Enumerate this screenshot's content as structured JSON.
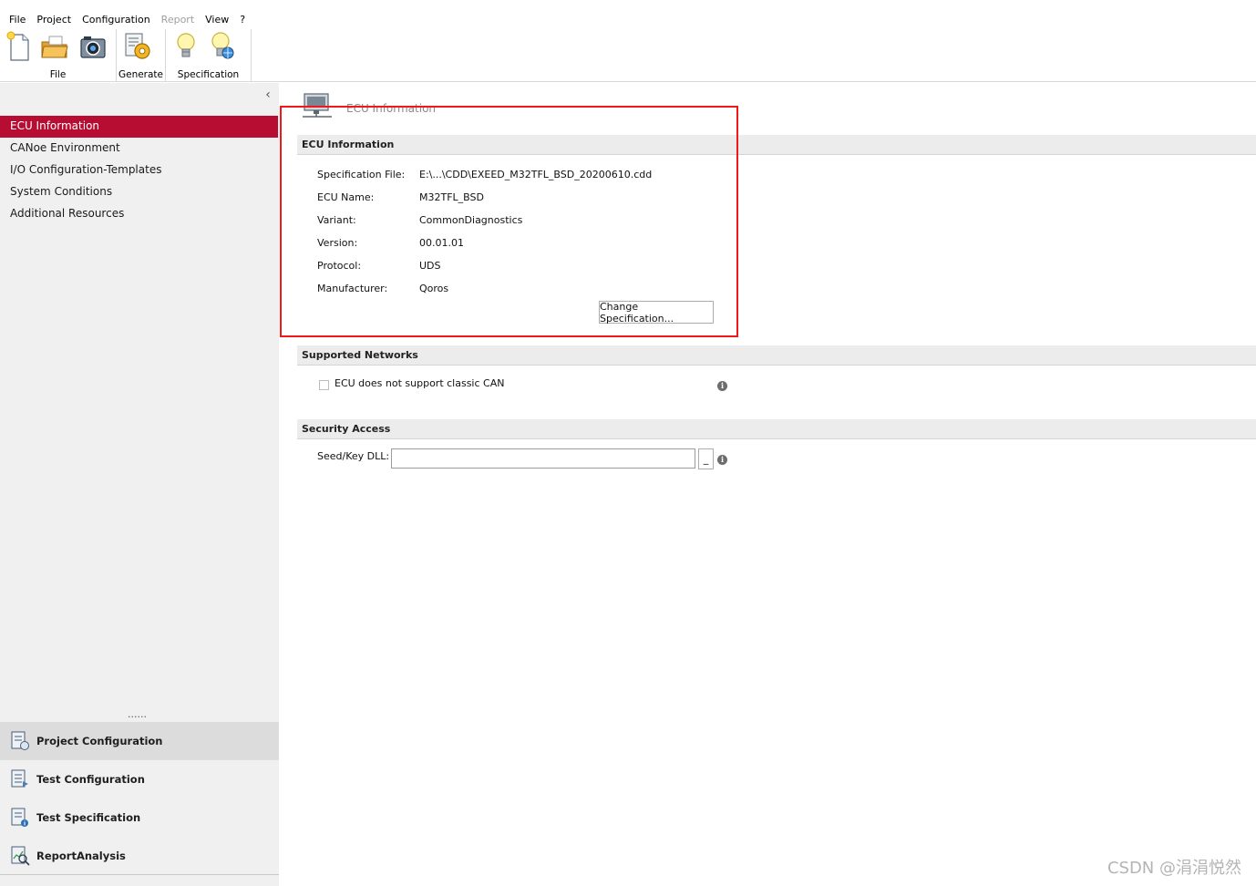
{
  "menu": {
    "items": [
      "File",
      "Project",
      "Configuration",
      "Report",
      "View",
      "?"
    ],
    "disabled": [
      "Report"
    ]
  },
  "ribbon": {
    "groups": {
      "file": "File",
      "generate": "Generate",
      "specification": "Specification"
    },
    "icons": [
      "new-file-icon",
      "open-folder-icon",
      "camera-icon",
      "generate-gear-icon",
      "bulb-icon",
      "bulb-globe-icon"
    ]
  },
  "sidebar": {
    "collapse_glyph": "‹",
    "items": [
      {
        "label": "ECU Information",
        "active": true
      },
      {
        "label": "CANoe Environment"
      },
      {
        "label": "I/O Configuration-Templates"
      },
      {
        "label": "System Conditions"
      },
      {
        "label": "Additional Resources"
      }
    ],
    "grip": "......",
    "bottom_items": [
      {
        "label": "Project Configuration",
        "icon": "project-config-icon",
        "selected": true
      },
      {
        "label": "Test Configuration",
        "icon": "test-config-icon"
      },
      {
        "label": "Test Specification",
        "icon": "test-spec-icon"
      },
      {
        "label": "ReportAnalysis",
        "icon": "report-analysis-icon"
      }
    ]
  },
  "main": {
    "page_title": "ECU Information",
    "ecu_info": {
      "header": "ECU Information",
      "fields": [
        {
          "label": "Specification File:",
          "value": "E:\\...\\CDD\\EXEED_M32TFL_BSD_20200610.cdd"
        },
        {
          "label": "ECU Name:",
          "value": "M32TFL_BSD"
        },
        {
          "label": "Variant:",
          "value": "CommonDiagnostics"
        },
        {
          "label": "Version:",
          "value": "00.01.01"
        },
        {
          "label": "Protocol:",
          "value": "UDS"
        },
        {
          "label": "Manufacturer:",
          "value": "Qoros"
        }
      ],
      "change_button": "Change Specification..."
    },
    "networks": {
      "header": "Supported Networks",
      "checkbox_label": "ECU does not support classic CAN",
      "checked": false
    },
    "security": {
      "header": "Security Access",
      "seed_label": "Seed/Key DLL:",
      "seed_value": "",
      "browse_label": "_"
    },
    "info_glyph": "i"
  },
  "watermark": "CSDN @涓涓悦然",
  "colors": {
    "accent": "#b70d33",
    "highlight": "#f01818"
  }
}
